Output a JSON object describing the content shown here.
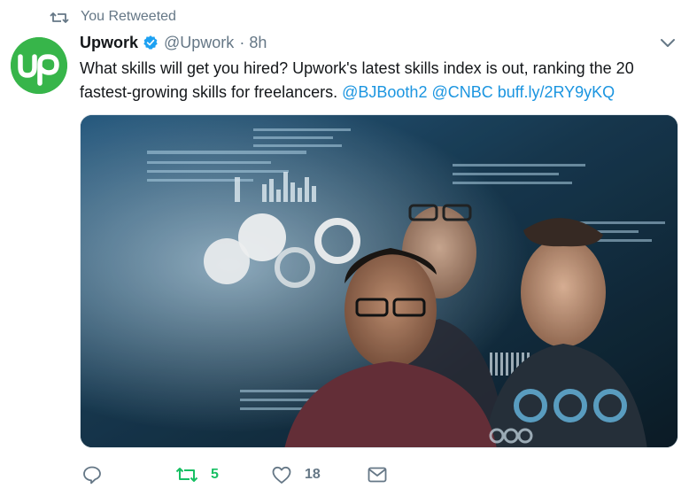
{
  "retweet_context": {
    "label": "You Retweeted",
    "icon": "retweet-icon"
  },
  "author": {
    "display_name": "Upwork",
    "handle": "@Upwork",
    "separator": "·",
    "time": "8h",
    "verified": true,
    "avatar_text": "up",
    "avatar_color": "#37b54a"
  },
  "tweet": {
    "line1": "What skills will get you hired? Upwork's latest skills index is out, ranking the 20",
    "line2_text": "fastest-growing skills for freelancers.",
    "mention1": "@BJBooth2",
    "mention2": "@CNBC",
    "link": "buff.ly/2RY9yKQ"
  },
  "media": {
    "description_icon": "photo-people-hologram"
  },
  "actions": {
    "reply_icon": "reply-icon",
    "retweet_count": "5",
    "like_count": "18",
    "dm_icon": "envelope-icon"
  },
  "colors": {
    "link": "#1b95e0",
    "retweeted": "#17bf63",
    "muted": "#657786",
    "verified": "#1da1f2"
  }
}
